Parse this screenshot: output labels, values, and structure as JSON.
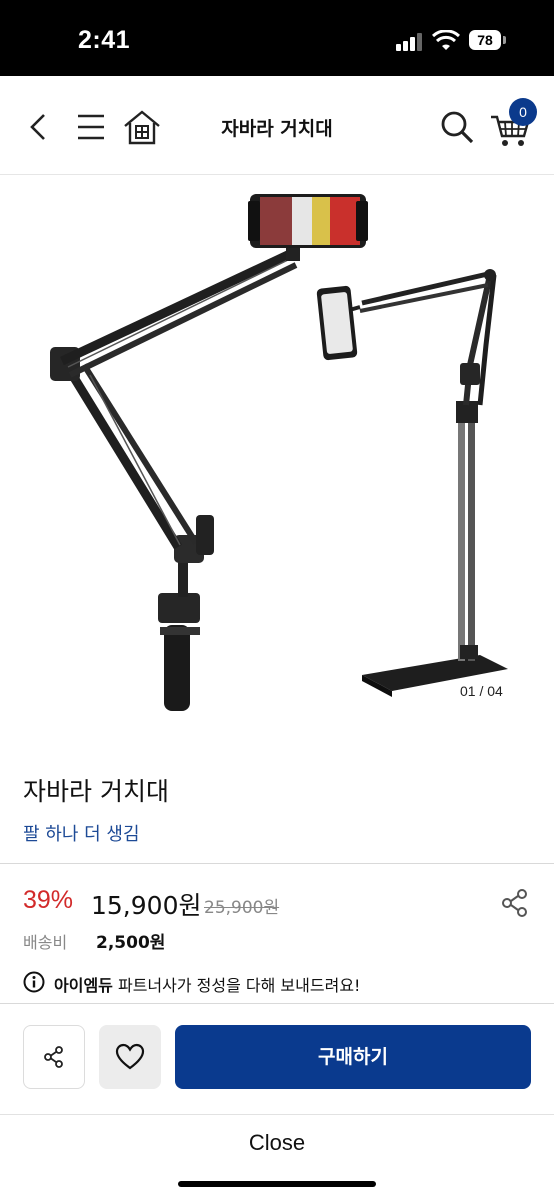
{
  "status_bar": {
    "time": "2:41",
    "battery": "78"
  },
  "header": {
    "title": "자바라 거치대",
    "cart_count": "0"
  },
  "gallery": {
    "counter": "01 / 04"
  },
  "product": {
    "name": "자바라 거치대",
    "tagline": "팔 하나 더 생김",
    "discount": "39%",
    "price": "15,900원",
    "original_price": "25,900원",
    "shipping_label": "배송비",
    "shipping_value": "2,500원",
    "notice_brand": "아이엠듀",
    "notice_text": " 파트너사가 정성을 다해 보내드려요!"
  },
  "actions": {
    "buy_label": "구매하기",
    "close_label": "Close"
  },
  "colors": {
    "brand_blue": "#0a3a8e",
    "discount_red": "#d22a2a",
    "tagline_blue": "#1d4a96"
  }
}
